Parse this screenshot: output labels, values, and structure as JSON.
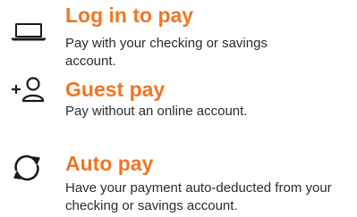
{
  "options": [
    {
      "title": "Log in to pay",
      "description": "Pay with your checking or savings account.",
      "icon": "laptop-icon"
    },
    {
      "title": "Guest pay",
      "description": "Pay without an online account.",
      "icon": "add-person-icon"
    },
    {
      "title": "Auto pay",
      "description": "Have your payment auto-deducted from your checking or savings account.",
      "icon": "sync-icon"
    }
  ],
  "colors": {
    "accent": "#ee7623",
    "icon": "#1a1a1a",
    "text": "#2b2b2b"
  }
}
